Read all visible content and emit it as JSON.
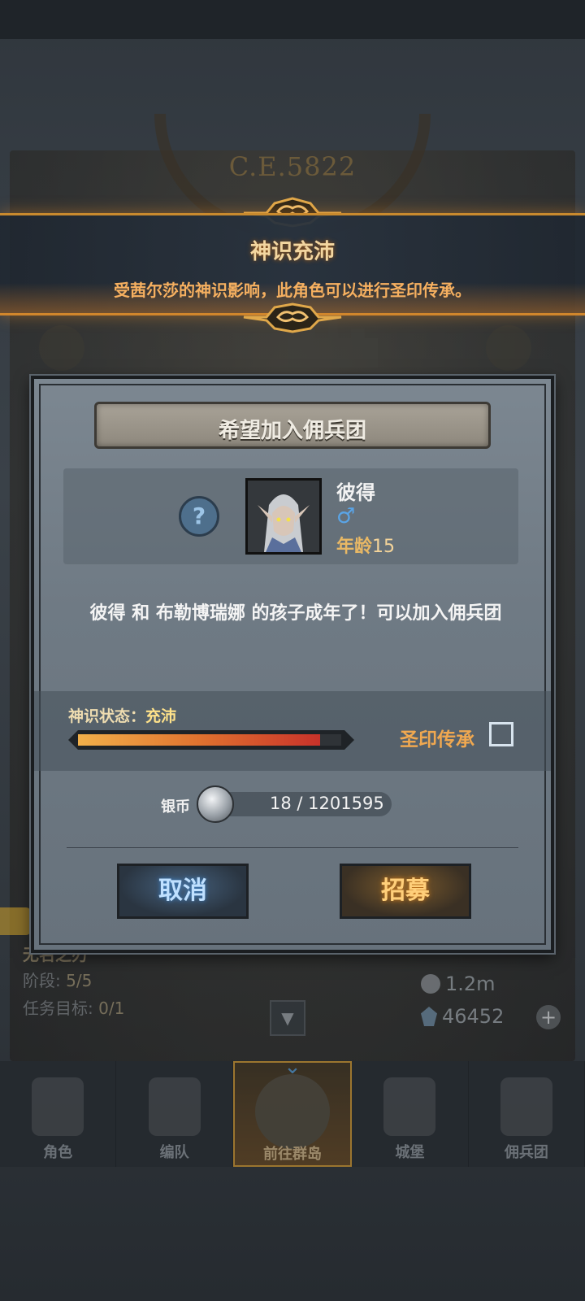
{
  "background": {
    "year": "C.E.5822",
    "quest": {
      "title": "无名之刃",
      "stage_label": "阶段:",
      "stage_value": "5/5",
      "target_label": "任务目标:",
      "target_value": "0/1"
    },
    "resources": {
      "silver": "1.2m",
      "gems": "46452"
    },
    "nav": [
      {
        "label": "角色",
        "icon": "character-icon"
      },
      {
        "label": "编队",
        "icon": "formation-icon"
      },
      {
        "label": "前往群岛",
        "icon": "globe-icon",
        "active": true
      },
      {
        "label": "城堡",
        "icon": "castle-icon"
      },
      {
        "label": "佣兵团",
        "icon": "mercenary-icon"
      }
    ]
  },
  "banner": {
    "title": "神识充沛",
    "description": "受茜尔莎的神识影响，此角色可以进行圣印传承。"
  },
  "dialog": {
    "title": "希望加入佣兵团",
    "character": {
      "name": "彼得",
      "gender": "male",
      "age_label": "年龄",
      "age": "15"
    },
    "message": "彼得 和 布勒博瑞娜 的孩子成年了！可以加入佣兵团",
    "status": {
      "label": "神识状态：",
      "value": "充沛",
      "progress": 0.92
    },
    "inherit": {
      "label": "圣印传承",
      "checked": false
    },
    "cost": {
      "label": "银币",
      "value": "18 / 1201595"
    },
    "buttons": {
      "cancel": "取消",
      "recruit": "招募"
    }
  },
  "colors": {
    "accent_orange": "#f0a850",
    "banner_border": "#c98a2e",
    "cancel_text": "#bfe0ff",
    "recruit_text": "#ffcf7a"
  }
}
